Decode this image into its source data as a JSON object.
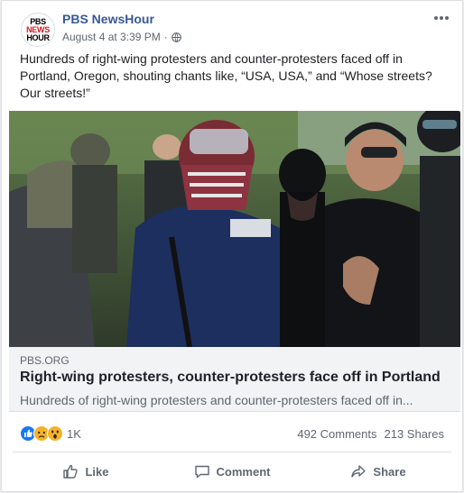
{
  "post": {
    "page_name": "PBS NewsHour",
    "logo_lines": [
      "PBS",
      "NEWS",
      "HOUR"
    ],
    "timestamp": "August 4 at 3:39 PM",
    "separator": "·",
    "privacy_icon": "globe-icon",
    "more_icon": "more-options-icon",
    "text": "Hundreds of right-wing protesters and counter-protesters faced off in Portland, Oregon, shouting chants like, “USA, USA,” and “Whose streets? Our streets!”"
  },
  "link": {
    "domain": "PBS.ORG",
    "title": "Right-wing protesters, counter-protesters face off in Portland",
    "description": "Hundreds of right-wing protesters and counter-protesters faced off in..."
  },
  "reactions": {
    "icons": [
      "like-reaction-icon",
      "sad-reaction-icon",
      "wow-reaction-icon"
    ],
    "count": "1K",
    "comments": "492 Comments",
    "shares": "213 Shares"
  },
  "actions": {
    "like_label": "Like",
    "comment_label": "Comment",
    "share_label": "Share"
  },
  "colors": {
    "link_blue": "#385898",
    "text_secondary": "#606770",
    "like_blue": "#1877f2",
    "reaction_yellow": "#f7b125",
    "pbs_red": "#d7191c"
  }
}
